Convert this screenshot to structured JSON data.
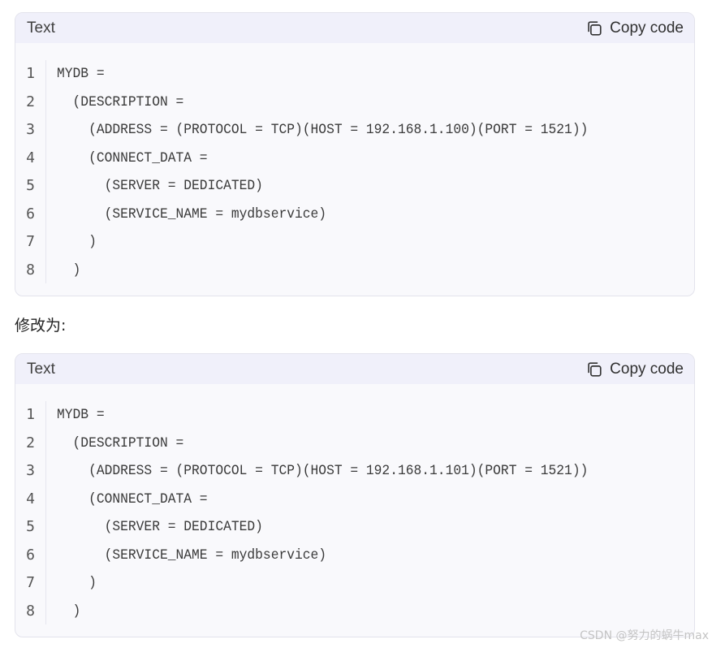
{
  "blocks": [
    {
      "lang": "Text",
      "copy_label": "Copy code",
      "line_numbers": [
        "1",
        "2",
        "3",
        "4",
        "5",
        "6",
        "7",
        "8"
      ],
      "lines": [
        "MYDB =",
        "  (DESCRIPTION =",
        "    (ADDRESS = (PROTOCOL = TCP)(HOST = 192.168.1.100)(PORT = 1521))",
        "    (CONNECT_DATA =",
        "      (SERVER = DEDICATED)",
        "      (SERVICE_NAME = mydbservice)",
        "    )",
        "  )"
      ]
    },
    {
      "lang": "Text",
      "copy_label": "Copy code",
      "line_numbers": [
        "1",
        "2",
        "3",
        "4",
        "5",
        "6",
        "7",
        "8"
      ],
      "lines": [
        "MYDB =",
        "  (DESCRIPTION =",
        "    (ADDRESS = (PROTOCOL = TCP)(HOST = 192.168.1.101)(PORT = 1521))",
        "    (CONNECT_DATA =",
        "      (SERVER = DEDICATED)",
        "      (SERVICE_NAME = mydbservice)",
        "    )",
        "  )"
      ]
    }
  ],
  "between_text": "修改为:",
  "watermark": "CSDN @努力的蜗牛max",
  "icons": {
    "copy": "copy-icon"
  },
  "colors": {
    "header_bg": "#f0f0fa",
    "body_bg": "#f9f9fc",
    "border": "#e3e3ec"
  }
}
